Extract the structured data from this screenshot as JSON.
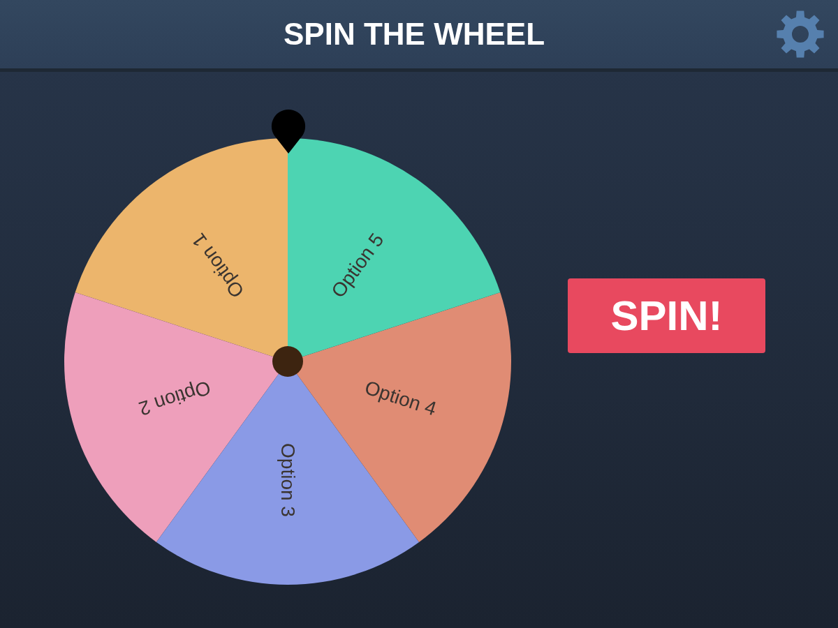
{
  "header": {
    "title": "SPIN THE WHEEL"
  },
  "wheel": {
    "segments": [
      {
        "label": "Option 1",
        "color": "#ecb56c"
      },
      {
        "label": "Option 2",
        "color": "#ee9fbb"
      },
      {
        "label": "Option 3",
        "color": "#8a9ae6"
      },
      {
        "label": "Option 4",
        "color": "#e08c74"
      },
      {
        "label": "Option 5",
        "color": "#4dd4b2"
      }
    ]
  },
  "spin_button": {
    "label": "SPIN!"
  }
}
